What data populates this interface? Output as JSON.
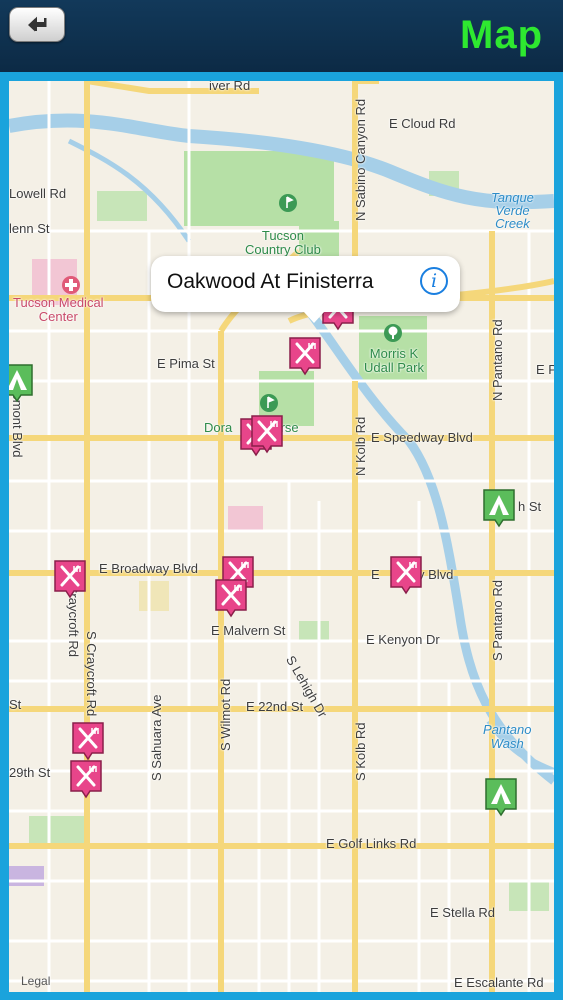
{
  "header": {
    "title": "Map",
    "back_button": "back-arrow-icon"
  },
  "callout": {
    "title": "Oakwood At Finisterra",
    "info_icon": "info-icon"
  },
  "legal": "Legal",
  "labels": {
    "e_cloud_rd": "E Cloud Rd",
    "lowell_rd": "Lowell Rd",
    "glenn_st": "lenn St",
    "tucson_country_club": "Tucson\nCountry Club",
    "tucson_medical_center": "Tucson Medical\nCenter",
    "e_pima_st": "E Pima St",
    "morris_k_udall_park": "Morris K\nUdall Park",
    "dorado_golf_course": "Dora    lf Course",
    "e_speedway_blvd": "E Speedway Blvd",
    "e_broadway_blvd_w": "E Broadway Blvd",
    "e_broadway_blvd_e": "E    dway Blvd",
    "e_malvern_st": "E Malvern St",
    "e_kenyon_dr": "E Kenyon Dr",
    "e_22nd_st": "E 22nd St",
    "e_29th_st": "29th St",
    "e_golf_links_rd": "E Golf Links Rd",
    "e_stella_rd": "E Stella Rd",
    "e_escalante_rd": "E Escalante Rd",
    "tanque_verde_creek": "Tanque\nVerde\nCreek",
    "pantano_wash": "Pantano\nWash",
    "e_pi": "E Pi",
    "st_frag": "h St",
    "n_sabino_canyon_rd": "N Sabino Canyon Rd",
    "n_kolb_rd": "N Kolb Rd",
    "n_pantano_rd": "N Pantano Rd",
    "s_pantano_rd": "S Pantano Rd",
    "n_craycroft_rd": "N Craycroft Rd",
    "s_craycroft_rd": "S Craycroft Rd",
    "s_sahuara_ave": "S Sahuara Ave",
    "s_wilmot_rd": "S Wilmot Rd",
    "s_lehigh_dr": "S Lehigh Dr",
    "s_kolb_rd": "S Kolb Rd",
    "rosemont_blvd": "semont Blvd",
    "st_left": "St",
    "river_rd": "iver Rd"
  },
  "pins": [
    {
      "type": "restaurant",
      "icon": "restaurant-pin-icon"
    },
    {
      "type": "restaurant",
      "icon": "restaurant-pin-icon"
    },
    {
      "type": "restaurant",
      "icon": "restaurant-pin-icon"
    },
    {
      "type": "restaurant",
      "icon": "restaurant-pin-icon"
    },
    {
      "type": "restaurant",
      "icon": "restaurant-pin-icon"
    },
    {
      "type": "restaurant",
      "icon": "restaurant-pin-icon"
    },
    {
      "type": "restaurant",
      "icon": "restaurant-pin-icon"
    },
    {
      "type": "restaurant",
      "icon": "restaurant-pin-icon"
    },
    {
      "type": "restaurant",
      "icon": "restaurant-pin-icon"
    },
    {
      "type": "restaurant",
      "icon": "restaurant-pin-icon"
    },
    {
      "type": "campground",
      "icon": "campground-pin-icon"
    },
    {
      "type": "campground",
      "icon": "campground-pin-icon"
    },
    {
      "type": "campground",
      "icon": "campground-pin-icon"
    }
  ],
  "colors": {
    "header": "#12395a",
    "title": "#2ee830",
    "frame": "#1aa3dc",
    "map_bg": "#f4f0e6",
    "road_major": "#f5d77a",
    "water": "#a6cfe8",
    "park": "#9ad68f",
    "restaurant": "#e8458a",
    "campground": "#5bbd5b"
  }
}
